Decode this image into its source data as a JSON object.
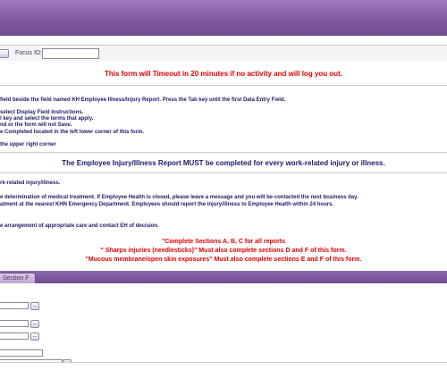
{
  "focus": {
    "label": "Focus ID:",
    "value": ""
  },
  "timeout_message": "This form will Timeout in 20 minutes if no activity and will log you out.",
  "instructions": [
    "field beside the field named KH Employee Illness/Injury Report. Press the Tab key until the first Data Entry Field.",
    "select Display Field Instructions.",
    "l key and select the terms that apply.",
    "nd or the form will not Save.",
    "e Completed located in the left lower corner of this form.",
    "the upper right corner"
  ],
  "must_notice": "The Employee Injury/Illness Report MUST be completed for every work-related injury or illness.",
  "work_related": "rk-related injury/illness.",
  "treatment_lines": [
    "e determination of medical treatment. If Employee Health is closed, please leave a message and you will be contacted the next business day.",
    "atment at the nearest KHN Emergency Department. Employees should report the injury/illness to Employee Health within 24 hours."
  ],
  "arrangement": "e arrangement of appropriate care and contact EH of decision.",
  "sections_notes": [
    "\"Complete Sections A, B, C for all reports",
    "\" Sharps injuries (needlesticks)\" Must also complete sections D and F of this form.",
    "\"Mucous membrane/open skin exposures\" Must also complete sections E and F of this form."
  ],
  "tab_label": "Section F",
  "ellipsis": "..."
}
